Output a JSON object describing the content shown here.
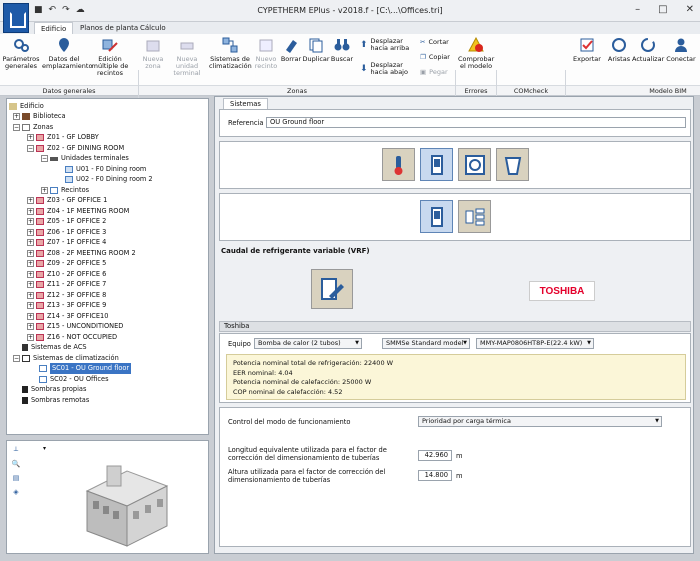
{
  "window": {
    "title": "CYPETHERM EPlus - v2018.f - [C:\\...\\Offices.tri]"
  },
  "tabs": [
    {
      "label": "Edificio"
    },
    {
      "label": "Planos de planta"
    },
    {
      "label": "Cálculo"
    }
  ],
  "ribbon": {
    "datos": [
      "Parámetros generales",
      "Datos del emplazamiento",
      "Edición múltiple de recintos"
    ],
    "zonas": [
      "Nueva zona",
      "Nueva unidad terminal",
      "Sistemas de climatización",
      "Nuevo recinto",
      "Borrar",
      "Duplicar",
      "Buscar"
    ],
    "move": [
      "Desplazar hacia arriba",
      "Desplazar hacia abajo"
    ],
    "clip": [
      "Cortar",
      "Copiar",
      "Pegar"
    ],
    "errores": [
      "Comprobar el modelo"
    ],
    "export": [
      "Exportar"
    ],
    "bim": [
      "Aristas",
      "Actualizar",
      "Conectar"
    ],
    "groups": [
      "Datos generales",
      "Zonas",
      "Errores",
      "COMcheck",
      "Modelo BIM"
    ]
  },
  "tree": {
    "edificio": "Edificio",
    "biblioteca": "Biblioteca",
    "zonas": "Zonas",
    "z01": "Z01 - GF LOBBY",
    "z02": "Z02 - GF DINING ROOM",
    "unidades": "Unidades terminales",
    "u01": "U01 - F0 Dining room",
    "u02": "U02 - F0 Dining room 2",
    "recintos": "Recintos",
    "zlist": [
      "Z03 - GF OFFICE 1",
      "Z04 - 1F MEETING ROOM",
      "Z05 - 1F OFFICE 2",
      "Z06 - 1F OFFICE 3",
      "Z07 - 1F OFFICE 4",
      "Z08 - 2F MEETING ROOM 2",
      "Z09 - 2F OFFICE 5",
      "Z10 - 2F OFFICE 6",
      "Z11 - 2F OFFICE 7",
      "Z12 - 3F OFFICE 8",
      "Z13 - 3F OFFICE 9",
      "Z14 - 3F OFFICE10",
      "Z15 - UNCONDITIONED",
      "Z16 - NOT OCCUPIED"
    ],
    "acs": "Sistemas de ACS",
    "clim": "Sistemas de climatización",
    "sc01": "SC01 - OU Ground floor",
    "sc02": "SC02 - OU Offices",
    "sombras_propias": "Sombras propias",
    "sombras_remotas": "Sombras remotas"
  },
  "main": {
    "tab": "Sistemas",
    "ref_label": "Referencia",
    "ref_value": "OU Ground floor",
    "vrf_title": "Caudal de refrigerante variable (VRF)",
    "brand": "TOSHIBA",
    "section": "Toshiba",
    "equipo_label": "Equipo",
    "equipo": "Bomba de calor (2 tubos)",
    "modelo_serie": "SMMSe Standard model",
    "modelo": "MMY-MAP0806HT8P-E(22.4 kW)",
    "info": [
      "Potencia nominal total de refrigeración: 22400 W",
      "EER nominal: 4.04",
      "Potencia nominal de calefacción: 25000 W",
      "COP nominal de calefacción: 4.52"
    ],
    "control_label": "Control del modo de funcionamiento",
    "control_value": "Prioridad por carga térmica",
    "long_label": "Longitud equivalente utilizada para el factor de corrección del dimensionamiento de tuberías",
    "long_value": "42.960",
    "alt_label": "Altura utilizada para el factor de corrección del dimensionamiento de tuberías",
    "alt_value": "14.800",
    "unit": "m"
  }
}
